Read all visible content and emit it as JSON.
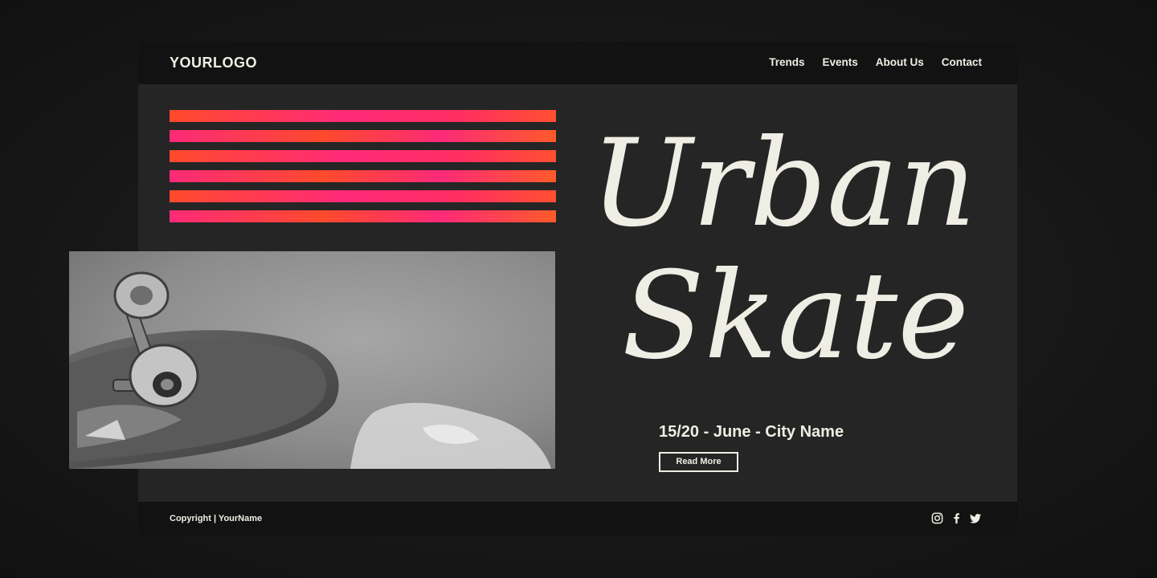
{
  "header": {
    "logo": "YOURLOGO",
    "nav": [
      "Trends",
      "Events",
      "About Us",
      "Contact"
    ]
  },
  "hero": {
    "title_line1": "Urban",
    "title_line2": "Skate",
    "date": "15/20 - June - City Name",
    "button_label": "Read More",
    "image_icon": "skateboard-photo"
  },
  "footer": {
    "copyright": "Copyright | YourName",
    "social_icons": [
      "instagram-icon",
      "facebook-icon",
      "twitter-icon"
    ]
  },
  "colors": {
    "accent_pink": "#ff2a78",
    "accent_orange": "#ff4a2c",
    "text_cream": "#efeee4",
    "panel": "#252525",
    "bar": "#121212"
  }
}
